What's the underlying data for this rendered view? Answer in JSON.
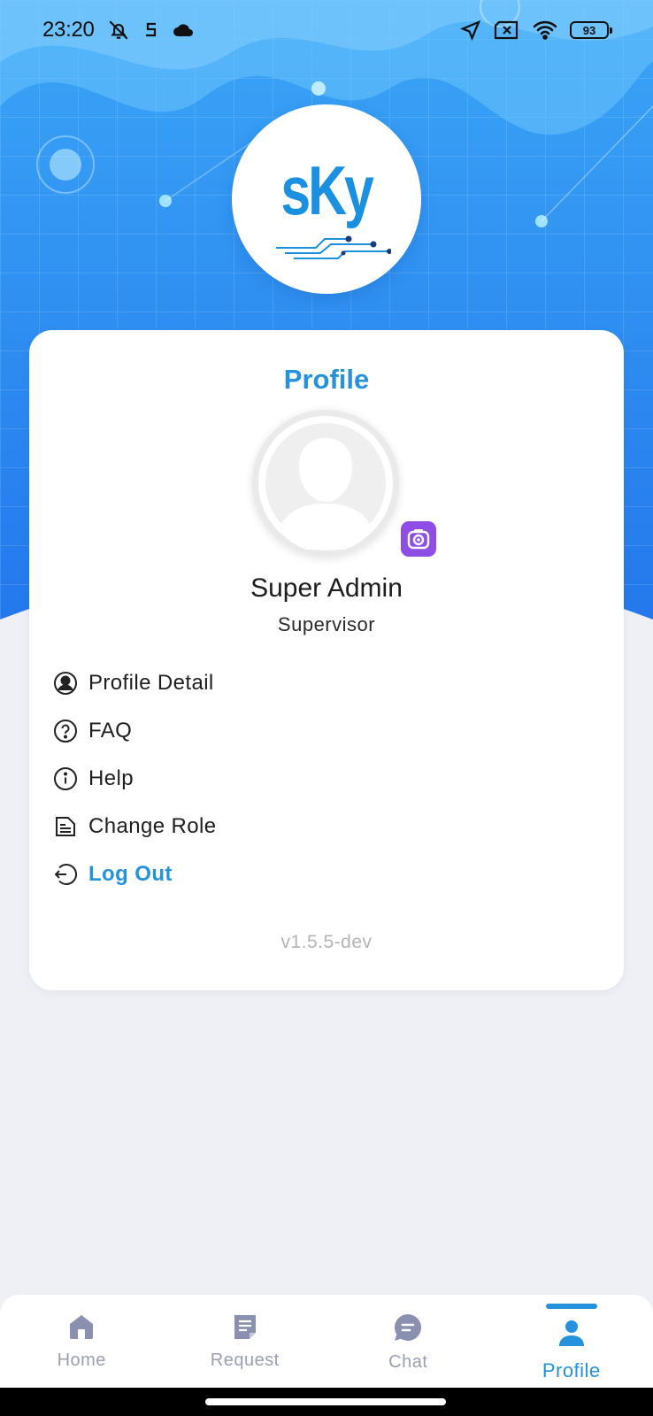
{
  "status_bar": {
    "time": "23:20",
    "battery": "93",
    "icons": [
      "alarm-off-icon",
      "s-app-icon",
      "cloud-icon",
      "location-arrow-icon",
      "sim-x-icon",
      "wifi-icon",
      "battery-icon"
    ]
  },
  "logo": {
    "text": "sKy"
  },
  "card": {
    "title": "Profile",
    "user_name": "Super Admin",
    "user_role": "Supervisor",
    "version": "v1.5.5-dev"
  },
  "menu": {
    "items": [
      {
        "label": "Profile Detail",
        "icon": "user-circle-icon"
      },
      {
        "label": "FAQ",
        "icon": "question-circle-icon"
      },
      {
        "label": "Help",
        "icon": "info-circle-icon"
      },
      {
        "label": "Change Role",
        "icon": "document-icon"
      },
      {
        "label": "Log Out",
        "icon": "logout-icon"
      }
    ]
  },
  "bottom_nav": {
    "items": [
      {
        "label": "Home",
        "icon": "home-icon",
        "active": false
      },
      {
        "label": "Request",
        "icon": "request-icon",
        "active": false
      },
      {
        "label": "Chat",
        "icon": "chat-icon",
        "active": false
      },
      {
        "label": "Profile",
        "icon": "profile-icon",
        "active": true
      }
    ]
  },
  "colors": {
    "accent": "#2492DD",
    "hero_blue": "#2A86F2",
    "camera_purple": "#8E4EE6",
    "nav_inactive": "#9AA0B2",
    "background": "#EEF0F6"
  }
}
